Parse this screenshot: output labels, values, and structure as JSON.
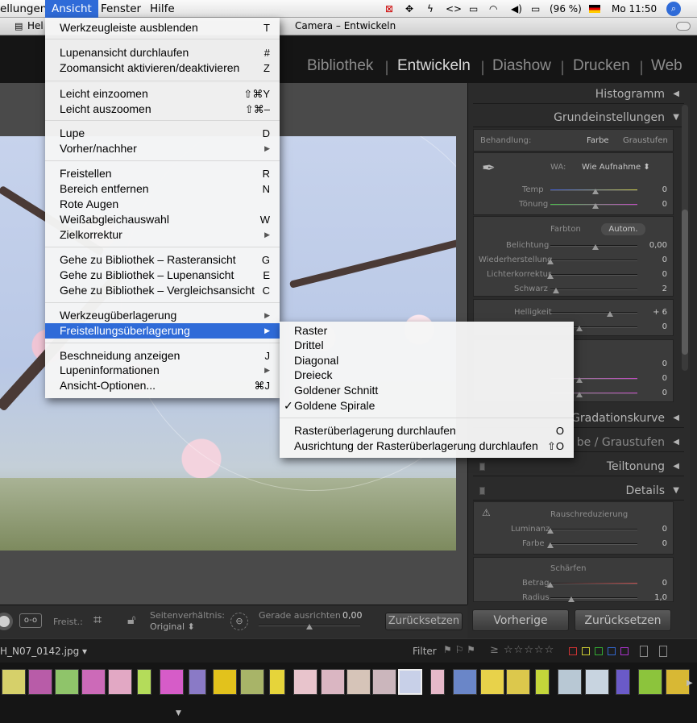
{
  "menubar": {
    "items": [
      "ellungen",
      "Ansicht",
      "Fenster",
      "Hilfe"
    ],
    "battery": "(96 %)",
    "clock": "Mo 11:50"
  },
  "window": {
    "title_start": "Hel",
    "title_tail": "Camera – Entwickeln"
  },
  "modules": [
    "Bibliothek",
    "Entwickeln",
    "Diashow",
    "Drucken",
    "Web"
  ],
  "menu_ansicht": [
    {
      "label": "Werkzeugleiste ausblenden",
      "shortcut": "T"
    },
    {
      "label": "Lupenansicht durchlaufen",
      "shortcut": "#"
    },
    {
      "label": "Zoomansicht aktivieren/deaktivieren",
      "shortcut": "Z"
    },
    {
      "label": "Leicht einzoomen",
      "shortcut": "⇧⌘Y"
    },
    {
      "label": "Leicht auszoomen",
      "shortcut": "⇧⌘–"
    },
    {
      "label": "Lupe",
      "shortcut": "D"
    },
    {
      "label": "Vorher/nachher",
      "shortcut": "▶"
    },
    {
      "label": "Freistellen",
      "shortcut": "R"
    },
    {
      "label": "Bereich entfernen",
      "shortcut": "N"
    },
    {
      "label": "Rote Augen",
      "shortcut": ""
    },
    {
      "label": "Weißabgleichauswahl",
      "shortcut": "W"
    },
    {
      "label": "Zielkorrektur",
      "shortcut": "▶"
    },
    {
      "label": "Gehe zu Bibliothek – Rasteransicht",
      "shortcut": "G"
    },
    {
      "label": "Gehe zu Bibliothek – Lupenansicht",
      "shortcut": "E"
    },
    {
      "label": "Gehe zu Bibliothek – Vergleichsansicht",
      "shortcut": "C"
    },
    {
      "label": "Werkzeugüberlagerung",
      "shortcut": "▶"
    },
    {
      "label": "Freistellungsüberlagerung",
      "shortcut": "▶"
    },
    {
      "label": "Beschneidung anzeigen",
      "shortcut": "J"
    },
    {
      "label": "Lupeninformationen",
      "shortcut": "▶"
    },
    {
      "label": "Ansicht-Optionen...",
      "shortcut": "⌘J"
    }
  ],
  "submenu_overlay": [
    {
      "label": "Raster",
      "shortcut": "",
      "checked": ""
    },
    {
      "label": "Drittel",
      "shortcut": "",
      "checked": ""
    },
    {
      "label": "Diagonal",
      "shortcut": "",
      "checked": ""
    },
    {
      "label": "Dreieck",
      "shortcut": "",
      "checked": ""
    },
    {
      "label": "Goldener Schnitt",
      "shortcut": "",
      "checked": ""
    },
    {
      "label": "Goldene Spirale",
      "shortcut": "",
      "checked": "✓"
    },
    {
      "label": "Rasterüberlagerung durchlaufen",
      "shortcut": "O",
      "checked": ""
    },
    {
      "label": "Ausrichtung der Rasterüberlagerung durchlaufen",
      "shortcut": "⇧O",
      "checked": ""
    }
  ],
  "panels": {
    "histogramm": "Histogramm",
    "grundeinstellungen": "Grundeinstellungen",
    "behandlung_label": "Behandlung:",
    "behandlung_options": [
      "Farbe",
      "Graustufen"
    ],
    "wa_label": "WA:",
    "wa_value": "Wie Aufnahme",
    "temp": {
      "label": "Temp",
      "value": "0"
    },
    "toenung": {
      "label": "Tönung",
      "value": "0"
    },
    "farbton": "Farbton",
    "autom": "Autom.",
    "belichtung": {
      "label": "Belichtung",
      "value": "0,00"
    },
    "wiederherstellung": {
      "label": "Wiederherstellung",
      "value": "0"
    },
    "lichterkorrektur": {
      "label": "Lichterkorrektur",
      "value": "0"
    },
    "schwarz": {
      "label": "Schwarz",
      "value": "2"
    },
    "helligkeit": {
      "label": "Helligkeit",
      "value": "+ 6"
    },
    "kontrast_value": "0",
    "hidden_values": [
      "0",
      "0",
      "0"
    ],
    "gradationskurve": "Gradationskurve",
    "farbe_graustufen": "be / Graustufen",
    "teiltonung": "Teiltonung",
    "details": "Details",
    "rauschreduzierung": "Rauschreduzierung",
    "luminanz": {
      "label": "Luminanz",
      "value": "0"
    },
    "farbe": {
      "label": "Farbe",
      "value": "0"
    },
    "schaerfen": "Schärfen",
    "betrag": {
      "label": "Betrag",
      "value": "0"
    },
    "radius": {
      "label": "Radius",
      "value": "1,0"
    }
  },
  "buttons": {
    "vorherige": "Vorherige",
    "zuruecksetzen": "Zurücksetzen"
  },
  "toolbar": {
    "freist": "Freist.:",
    "seitenverhaeltnis": "Seitenverhältnis:",
    "original": "Original",
    "gerade": "Gerade ausrichten",
    "gerade_value": "0,00",
    "reset": "Zurücksetzen"
  },
  "filmstrip": {
    "filename": "H_N07_0142.jpg",
    "filter": "Filter",
    "stars": "≥ ☆☆☆☆☆"
  }
}
